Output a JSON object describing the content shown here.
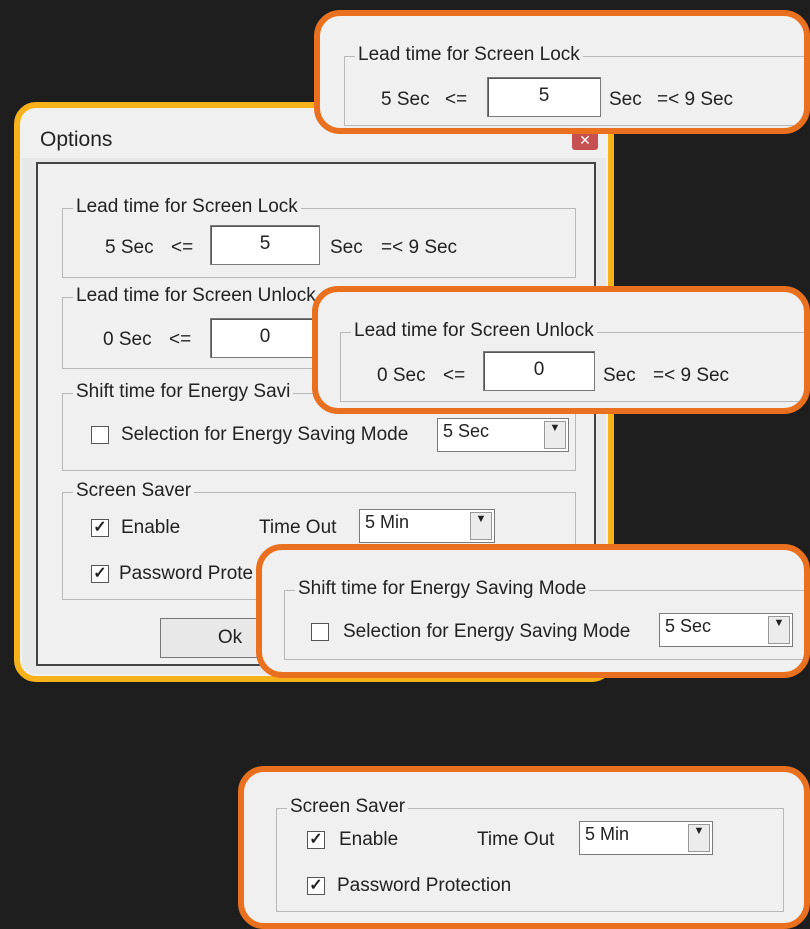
{
  "dialog": {
    "title": "Options",
    "close_icon": "close-icon",
    "lock": {
      "legend": "Lead time for Screen Lock",
      "min": "5 Sec",
      "lte": "<=",
      "value": "5",
      "unit": "Sec",
      "max": "=< 9 Sec"
    },
    "unlock": {
      "legend": "Lead time for Screen Unlock",
      "min": "0 Sec",
      "lte": "<=",
      "value": "0"
    },
    "energy": {
      "legend": "Shift time for Energy Savi",
      "checkbox_label": "Selection for Energy Saving Mode",
      "checked": false,
      "select_value": "5 Sec"
    },
    "saver": {
      "legend": "Screen Saver",
      "enable_label": "Enable",
      "enable_checked": true,
      "timeout_label": "Time Out",
      "timeout_value": "5 Min",
      "password_label": "Password Prote",
      "password_checked": true
    },
    "ok_label": "Ok"
  },
  "callouts": {
    "lock": {
      "legend": "Lead time for Screen Lock",
      "min": "5 Sec",
      "lte": "<=",
      "value": "5",
      "unit": "Sec",
      "max": "=< 9 Sec"
    },
    "unlock": {
      "legend": "Lead time for Screen Unlock",
      "min": "0 Sec",
      "lte": "<=",
      "value": "0",
      "unit": "Sec",
      "max": "=< 9 Sec"
    },
    "energy": {
      "legend": "Shift time for Energy Saving Mode",
      "checkbox_label": "Selection for Energy Saving Mode",
      "checked": false,
      "select_value": "5 Sec"
    },
    "saver": {
      "legend": "Screen Saver",
      "enable_label": "Enable",
      "enable_checked": true,
      "timeout_label": "Time Out",
      "timeout_value": "5 Min",
      "password_label": "Password Protection",
      "password_checked": true
    }
  },
  "colors": {
    "dialog_highlight": "#f7b21a",
    "callout_border": "#e8701f",
    "background": "#1e1e1e"
  }
}
